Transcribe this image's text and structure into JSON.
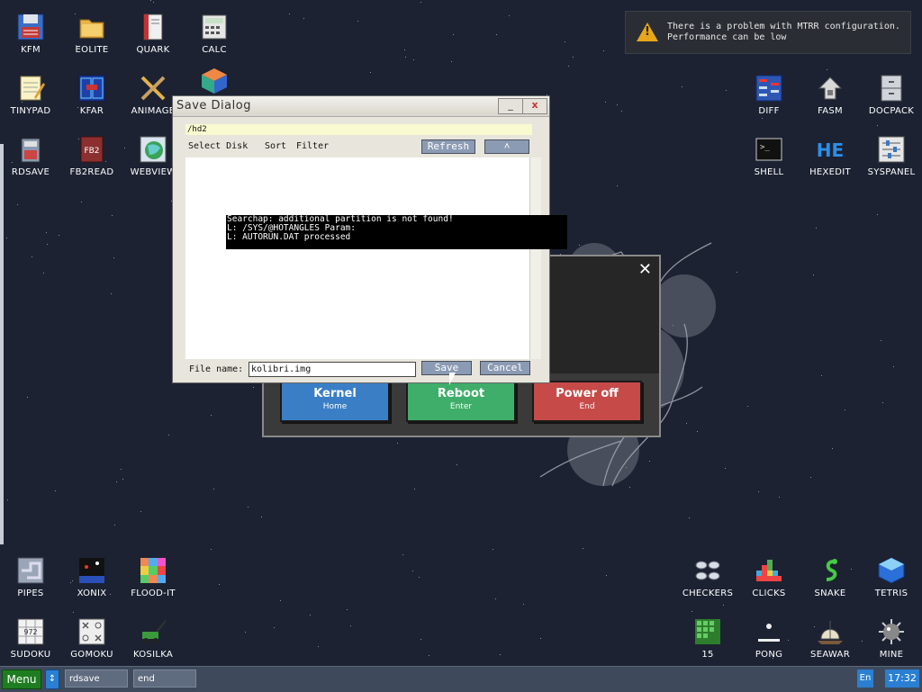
{
  "desktop": {
    "icons_top_left": [
      {
        "label": "KFM",
        "icon": "floppy-icon"
      },
      {
        "label": "EOLITE",
        "icon": "folder-icon"
      },
      {
        "label": "QUARK",
        "icon": "book-icon"
      },
      {
        "label": "CALC",
        "icon": "calculator-icon"
      },
      {
        "label": "TINYPAD",
        "icon": "notepad-icon"
      },
      {
        "label": "KFAR",
        "icon": "panels-icon"
      },
      {
        "label": "ANIMAGE",
        "icon": "brush-icon"
      },
      {
        "label": "RDSAVE",
        "icon": "save-disk-icon"
      },
      {
        "label": "FB2READ",
        "icon": "fb2-book-icon"
      },
      {
        "label": "WEBVIEW",
        "icon": "globe-icon"
      }
    ],
    "icons_top_right": [
      {
        "label": "DIFF",
        "icon": "diff-icon"
      },
      {
        "label": "FASM",
        "icon": "fasm-icon"
      },
      {
        "label": "DOCPACK",
        "icon": "cabinet-icon"
      },
      {
        "label": "SHELL",
        "icon": "terminal-icon"
      },
      {
        "label": "HEXEDIT",
        "icon": "hex-icon"
      },
      {
        "label": "SYSPANEL",
        "icon": "sliders-icon"
      }
    ],
    "icons_bottom_left": [
      {
        "label": "PIPES",
        "icon": "pipes-icon"
      },
      {
        "label": "XONIX",
        "icon": "xonix-icon"
      },
      {
        "label": "FLOOD-IT",
        "icon": "color-grid-icon"
      },
      {
        "label": "SUDOKU",
        "icon": "sudoku-icon"
      },
      {
        "label": "GOMOKU",
        "icon": "gomoku-icon"
      },
      {
        "label": "KOSILKA",
        "icon": "lawnmower-icon"
      }
    ],
    "icons_bottom_right": [
      {
        "label": "CHECKERS",
        "icon": "checkers-icon"
      },
      {
        "label": "CLICKS",
        "icon": "blocks-icon"
      },
      {
        "label": "SNAKE",
        "icon": "snake-icon"
      },
      {
        "label": "TETRIS",
        "icon": "tetris-icon"
      },
      {
        "label": "15",
        "icon": "fifteen-icon"
      },
      {
        "label": "PONG",
        "icon": "pong-icon"
      },
      {
        "label": "SEAWAR",
        "icon": "ship-icon"
      },
      {
        "label": "MINE",
        "icon": "mine-icon"
      }
    ]
  },
  "notification": {
    "line1": "There is a problem with MTRR configuration.",
    "line2": "Performance can be low"
  },
  "shutdown": {
    "buttons": [
      {
        "title": "Kernel",
        "sub": "Home",
        "color": "#3a7fc6"
      },
      {
        "title": "Reboot",
        "sub": "Enter",
        "color": "#3fae6a"
      },
      {
        "title": "Power off",
        "sub": "End",
        "color": "#c64a48"
      }
    ]
  },
  "save_dialog": {
    "title": "Save Dialog",
    "minimize": "_",
    "close": "x",
    "path": "/hd2",
    "menu": {
      "select_disk": "Select Disk",
      "sort": "Sort",
      "filter": "Filter"
    },
    "refresh": "Refresh",
    "up": "˄",
    "file_name_label": "File name:",
    "file_name_value": "kolibri.img",
    "save": "Save",
    "cancel": "Cancel"
  },
  "console": {
    "lines": [
      "Searchap: additional partition is not found!",
      "L: /SYS/@HOTANGLES Param:",
      "L: AUTORUN.DAT processed"
    ]
  },
  "taskbar": {
    "menu": "Menu",
    "arrow": "↕",
    "items": [
      "rdsave",
      "end"
    ],
    "lang": "En",
    "clock": "17:32"
  }
}
